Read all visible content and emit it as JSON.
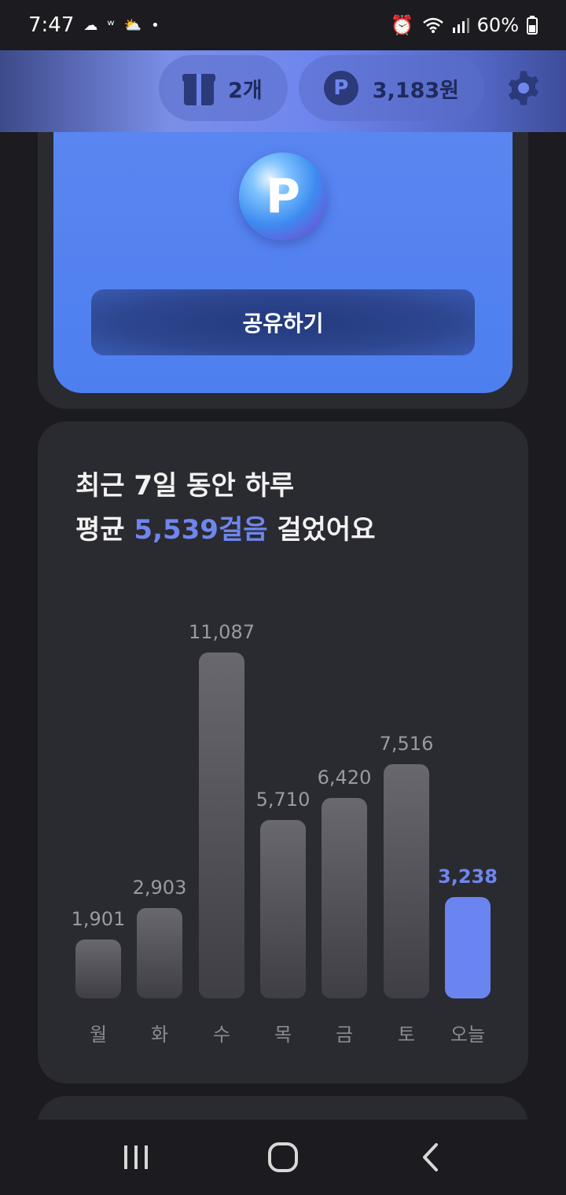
{
  "status_bar": {
    "time": "7:47",
    "battery": "60%"
  },
  "header": {
    "gift_count": "2개",
    "points": "3,183원",
    "points_icon_letter": "P"
  },
  "top_card": {
    "coin_letter": "P",
    "share_label": "공유하기"
  },
  "stats": {
    "title_line1": "최근 7일 동안 하루",
    "title_prefix": "평균 ",
    "title_accent": "5,539걸음",
    "title_suffix": " 걸었어요"
  },
  "chart_data": {
    "type": "bar",
    "categories": [
      "월",
      "화",
      "수",
      "목",
      "금",
      "토",
      "오늘"
    ],
    "values": [
      1901,
      2903,
      11087,
      5710,
      6420,
      7516,
      3238
    ],
    "value_labels": [
      "1,901",
      "2,903",
      "11,087",
      "5,710",
      "6,420",
      "7,516",
      "3,238"
    ],
    "highlight_index": 6,
    "colors": {
      "bar": "#5a5a60",
      "highlight": "#6a84f0"
    }
  }
}
